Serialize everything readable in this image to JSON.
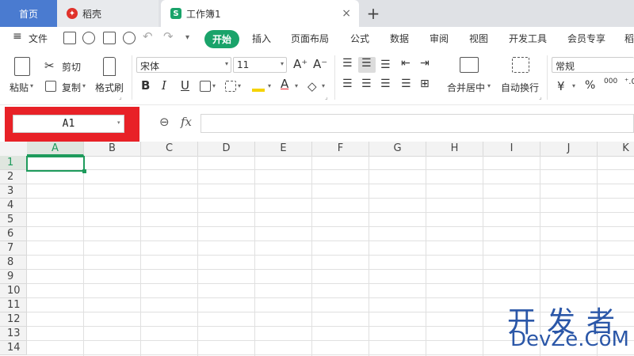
{
  "tabs": {
    "home": "首页",
    "daoke": "稻壳",
    "doc": "工作簿1",
    "doc_icon_letter": "S",
    "close": "×",
    "add": "+"
  },
  "menu": {
    "file": "文件",
    "items": [
      "开始",
      "插入",
      "页面布局",
      "公式",
      "数据",
      "审阅",
      "视图",
      "开发工具",
      "会员专享",
      "稻"
    ]
  },
  "ribbon": {
    "paste": "粘贴",
    "cut": "剪切",
    "copy": "复制",
    "format_painter": "格式刷",
    "font_name": "宋体",
    "font_size": "11",
    "bold": "B",
    "italic": "I",
    "underline": "U",
    "font_color_glyph": "A",
    "merge_center": "合并居中",
    "wrap_text": "自动换行",
    "number_format": "常规",
    "currency": "¥",
    "percent": "%",
    "thousands": "000",
    "grow_font": "A⁺",
    "shrink_font": "A⁻"
  },
  "formula_bar": {
    "name_box": "A1",
    "fx": "fx",
    "formula": ""
  },
  "sheet": {
    "columns": [
      "A",
      "B",
      "C",
      "D",
      "E",
      "F",
      "G",
      "H",
      "I",
      "J",
      "K"
    ],
    "rows": [
      "1",
      "2",
      "3",
      "4",
      "5",
      "6",
      "7",
      "8",
      "9",
      "10",
      "11",
      "12",
      "13",
      "14"
    ],
    "active_cell": "A1"
  },
  "watermark": {
    "line1": "开发者",
    "line2": "DevZe.CoM"
  },
  "colors": {
    "accent_green": "#1aa36a",
    "highlight_red": "#e82127",
    "home_tab_blue": "#4a7bd0"
  }
}
